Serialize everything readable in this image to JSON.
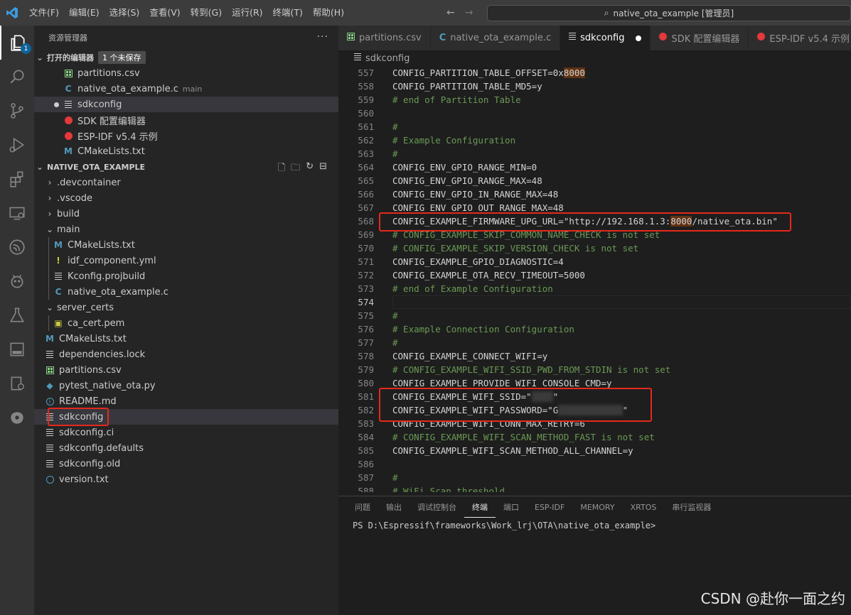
{
  "titlebar": {
    "menu": [
      "文件(F)",
      "编辑(E)",
      "选择(S)",
      "查看(V)",
      "转到(G)",
      "运行(R)",
      "终端(T)",
      "帮助(H)"
    ],
    "search_text": "native_ota_example [管理员]",
    "back_icon": "arrow-left-icon",
    "forward_icon": "arrow-right-icon"
  },
  "activity_badge": "1",
  "sidebar": {
    "title": "资源管理器",
    "more": "···",
    "open_editors": {
      "label": "打开的编辑器",
      "unsaved": "1 个未保存",
      "items": [
        {
          "name": "partitions.csv",
          "icon": "csv"
        },
        {
          "name": "native_ota_example.c",
          "icon": "c",
          "desc": "main"
        },
        {
          "name": "sdkconfig",
          "icon": "lines",
          "modified": true
        },
        {
          "name": "SDK 配置编辑器",
          "icon": "esp"
        },
        {
          "name": "ESP-IDF v5.4 示例",
          "icon": "esp"
        },
        {
          "name": "CMakeLists.txt",
          "icon": "m"
        }
      ]
    },
    "project": {
      "label": "NATIVE_OTA_EXAMPLE",
      "items": [
        {
          "name": ".devcontainer",
          "type": "folder",
          "depth": 0,
          "open": false
        },
        {
          "name": ".vscode",
          "type": "folder",
          "depth": 0,
          "open": false
        },
        {
          "name": "build",
          "type": "folder",
          "depth": 0,
          "open": false
        },
        {
          "name": "main",
          "type": "folder",
          "depth": 0,
          "open": true
        },
        {
          "name": "CMakeLists.txt",
          "icon": "m",
          "depth": 1
        },
        {
          "name": "idf_component.yml",
          "icon": "excl",
          "depth": 1
        },
        {
          "name": "Kconfig.projbuild",
          "icon": "lines",
          "depth": 1
        },
        {
          "name": "native_ota_example.c",
          "icon": "c",
          "depth": 1
        },
        {
          "name": "server_certs",
          "type": "folder",
          "depth": 0,
          "open": true
        },
        {
          "name": "ca_cert.pem",
          "icon": "lock",
          "depth": 1
        },
        {
          "name": "CMakeLists.txt",
          "icon": "m",
          "depth": 0
        },
        {
          "name": "dependencies.lock",
          "icon": "lines",
          "depth": 0
        },
        {
          "name": "partitions.csv",
          "icon": "csv",
          "depth": 0
        },
        {
          "name": "pytest_native_ota.py",
          "icon": "py",
          "depth": 0
        },
        {
          "name": "README.md",
          "icon": "info",
          "depth": 0
        },
        {
          "name": "sdkconfig",
          "icon": "lines",
          "depth": 0,
          "selected": true
        },
        {
          "name": "sdkconfig.ci",
          "icon": "lines",
          "depth": 0
        },
        {
          "name": "sdkconfig.defaults",
          "icon": "lines",
          "depth": 0
        },
        {
          "name": "sdkconfig.old",
          "icon": "lines",
          "depth": 0
        },
        {
          "name": "version.txt",
          "icon": "clock",
          "depth": 0
        }
      ]
    }
  },
  "tabs": [
    {
      "label": "partitions.csv",
      "icon": "csv"
    },
    {
      "label": "native_ota_example.c",
      "icon": "c"
    },
    {
      "label": "sdkconfig",
      "icon": "lines",
      "active": true,
      "modified": true
    },
    {
      "label": "SDK 配置编辑器",
      "icon": "esp"
    },
    {
      "label": "ESP-IDF v5.4 示例",
      "icon": "esp"
    }
  ],
  "breadcrumb": "sdkconfig",
  "editor": {
    "current_line": 574,
    "lines": [
      {
        "n": 557,
        "t": "CONFIG_PARTITION_TABLE_OFFSET=0x8000"
      },
      {
        "n": 558,
        "t": "CONFIG_PARTITION_TABLE_MD5=y"
      },
      {
        "n": 559,
        "t": "# end of Partition Table"
      },
      {
        "n": 560,
        "t": ""
      },
      {
        "n": 561,
        "t": "#"
      },
      {
        "n": 562,
        "t": "# Example Configuration"
      },
      {
        "n": 563,
        "t": "#"
      },
      {
        "n": 564,
        "t": "CONFIG_ENV_GPIO_RANGE_MIN=0"
      },
      {
        "n": 565,
        "t": "CONFIG_ENV_GPIO_RANGE_MAX=48"
      },
      {
        "n": 566,
        "t": "CONFIG_ENV_GPIO_IN_RANGE_MAX=48"
      },
      {
        "n": 567,
        "t": "CONFIG_ENV_GPIO_OUT_RANGE_MAX=48"
      },
      {
        "n": 568,
        "t": "CONFIG_EXAMPLE_FIRMWARE_UPG_URL=\"http://192.168.1.3:8000/native_ota.bin\""
      },
      {
        "n": 569,
        "t": "# CONFIG_EXAMPLE_SKIP_COMMON_NAME_CHECK is not set"
      },
      {
        "n": 570,
        "t": "# CONFIG_EXAMPLE_SKIP_VERSION_CHECK is not set"
      },
      {
        "n": 571,
        "t": "CONFIG_EXAMPLE_GPIO_DIAGNOSTIC=4"
      },
      {
        "n": 572,
        "t": "CONFIG_EXAMPLE_OTA_RECV_TIMEOUT=5000"
      },
      {
        "n": 573,
        "t": "# end of Example Configuration"
      },
      {
        "n": 574,
        "t": ""
      },
      {
        "n": 575,
        "t": "#"
      },
      {
        "n": 576,
        "t": "# Example Connection Configuration"
      },
      {
        "n": 577,
        "t": "#"
      },
      {
        "n": 578,
        "t": "CONFIG_EXAMPLE_CONNECT_WIFI=y"
      },
      {
        "n": 579,
        "t": "# CONFIG_EXAMPLE_WIFI_SSID_PWD_FROM_STDIN is not set"
      },
      {
        "n": 580,
        "t": "CONFIG_EXAMPLE_PROVIDE_WIFI_CONSOLE_CMD=y"
      },
      {
        "n": 581,
        "t": "CONFIG_EXAMPLE_WIFI_SSID=\"\""
      },
      {
        "n": 582,
        "t": "CONFIG_EXAMPLE_WIFI_PASSWORD=\"G\""
      },
      {
        "n": 583,
        "t": "CONFIG_EXAMPLE_WIFI_CONN_MAX_RETRY=6"
      },
      {
        "n": 584,
        "t": "# CONFIG_EXAMPLE_WIFI_SCAN_METHOD_FAST is not set"
      },
      {
        "n": 585,
        "t": "CONFIG_EXAMPLE_WIFI_SCAN_METHOD_ALL_CHANNEL=y"
      },
      {
        "n": 586,
        "t": ""
      },
      {
        "n": 587,
        "t": "#"
      },
      {
        "n": 588,
        "t": "# WiFi Scan threshold"
      }
    ]
  },
  "panel": {
    "tabs": [
      "问题",
      "输出",
      "调试控制台",
      "终端",
      "端口",
      "ESP-IDF",
      "MEMORY",
      "XRTOS",
      "串行监视器"
    ],
    "active_tab": "终端",
    "prompt": "PS D:\\Espressif\\frameworks\\Work_lrj\\OTA\\native_ota_example>"
  },
  "watermark": "CSDN @赴你一面之约",
  "colors": {
    "highlight_box": "#e5281c",
    "accent": "#0e639c",
    "comment": "#6a9955"
  }
}
